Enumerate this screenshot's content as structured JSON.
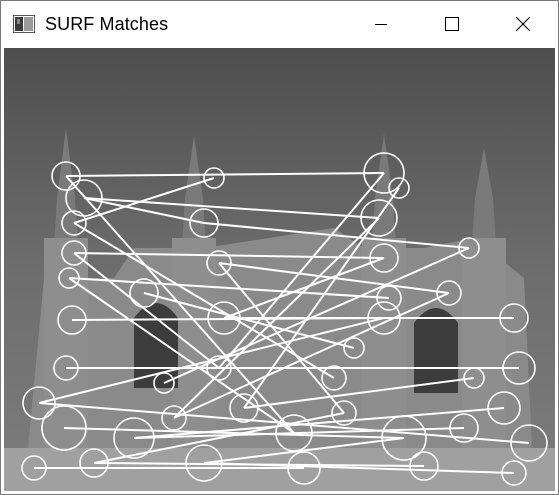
{
  "window": {
    "title": "SURF Matches",
    "icon": "opencv-window-icon",
    "controls": {
      "minimize": "minimize-icon",
      "maximize": "maximize-icon",
      "close": "close-icon"
    }
  },
  "image": {
    "subject": "grayscale-cathedral-with-feature-matches",
    "match_color": "#ffffff",
    "sky_color": "#5e5e5e",
    "building_color": "#8a8a8a"
  }
}
